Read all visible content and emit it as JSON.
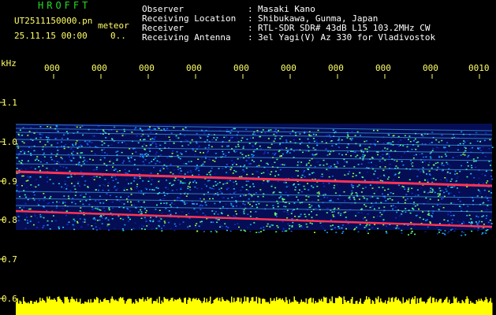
{
  "app": {
    "title": "HROFFT",
    "file_name": "UT2511150000.pn",
    "mode": "meteor",
    "date_time": "25.11.15 00:00",
    "extra": "0.."
  },
  "station": {
    "labels": [
      "Observer",
      "Receiving Location",
      "Receiver",
      "Receiving Antenna"
    ],
    "sep": ":",
    "values": [
      "Masaki Kano",
      "Shibukawa, Gunma, Japan",
      "RTL-SDR SDR# 43dB L15 103.2MHz CW",
      "3el Yagi(V) Az 330 for Vladivostok"
    ]
  },
  "axis": {
    "unit": "kHz",
    "y_ticks": [
      "1.1",
      "1.0",
      "0.9",
      "0.8",
      "0.7",
      "0.6"
    ],
    "x_ticks": [
      "000",
      "000",
      "000",
      "000",
      "000",
      "000",
      "000",
      "000",
      "000",
      "0010"
    ]
  },
  "colors": {
    "background": "#000000",
    "label_yellow": "#ffff66",
    "title_green": "#22dd22",
    "noise_base": "#0a1a9a",
    "signal_red": "#ff3355",
    "amplitude_yellow": "#ffff00"
  }
}
